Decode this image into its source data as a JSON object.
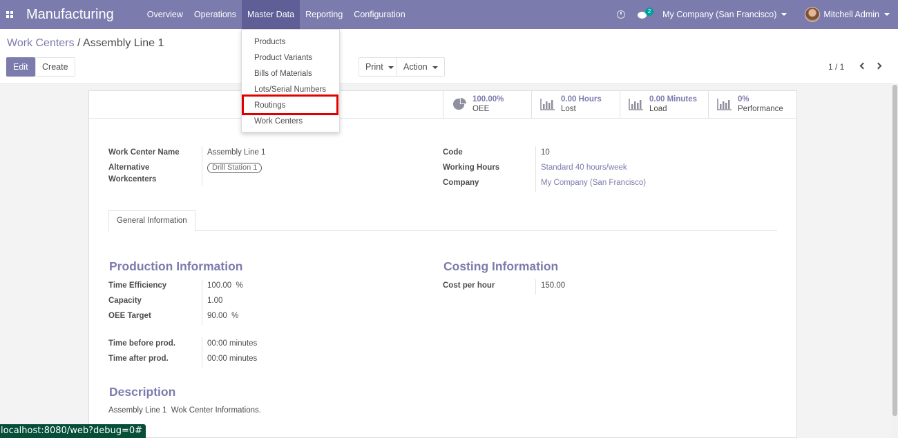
{
  "navbar": {
    "app_name": "Manufacturing",
    "menu": [
      "Overview",
      "Operations",
      "Master Data",
      "Reporting",
      "Configuration"
    ],
    "active_menu": "Master Data",
    "chat_badge": "2",
    "company": "My Company (San Francisco)",
    "user": "Mitchell Admin"
  },
  "breadcrumb": {
    "parent": "Work Centers",
    "separator": "/",
    "current": "Assembly Line 1"
  },
  "buttons": {
    "edit": "Edit",
    "create": "Create",
    "print": "Print",
    "action": "Action"
  },
  "pager": "1 / 1",
  "stat_buttons": [
    {
      "value": "100.00%",
      "label": "OEE",
      "icon": "pie-chart-icon"
    },
    {
      "value": "0.00 Hours",
      "label": "Lost",
      "icon": "bar-chart-icon"
    },
    {
      "value": "0.00 Minutes",
      "label": "Load",
      "icon": "bar-chart-icon"
    },
    {
      "value": "0%",
      "label": "Performance",
      "icon": "bar-chart-icon"
    }
  ],
  "form": {
    "work_center_name_label": "Work Center Name",
    "work_center_name": "Assembly Line 1",
    "alt_workcenters_label_1": "Alternative",
    "alt_workcenters_label_2": "Workcenters",
    "alt_workcenter_tag": "Drill Station 1",
    "code_label": "Code",
    "code": "10",
    "working_hours_label": "Working Hours",
    "working_hours": "Standard 40 hours/week",
    "company_label": "Company",
    "company": "My Company (San Francisco)"
  },
  "tab": "General Information",
  "production": {
    "title": "Production Information",
    "time_efficiency_label": "Time Efficiency",
    "time_efficiency": "100.00",
    "percent": "%",
    "capacity_label": "Capacity",
    "capacity": "1.00",
    "oee_target_label": "OEE Target",
    "oee_target": "90.00",
    "time_before_label": "Time before prod.",
    "time_before": "00:00 minutes",
    "time_after_label": "Time after prod.",
    "time_after": "00:00 minutes"
  },
  "costing": {
    "title": "Costing Information",
    "cost_label": "Cost per hour",
    "cost": "150.00"
  },
  "description": {
    "title": "Description",
    "text": "Assembly Line 1  Wok Center Informations."
  },
  "dropdown": [
    "Products",
    "Product Variants",
    "Bills of Materials",
    "Lots/Serial Numbers",
    "Routings",
    "Work Centers"
  ],
  "highlighted_item": "Routings",
  "status_url": "localhost:8080/web?debug=0#"
}
